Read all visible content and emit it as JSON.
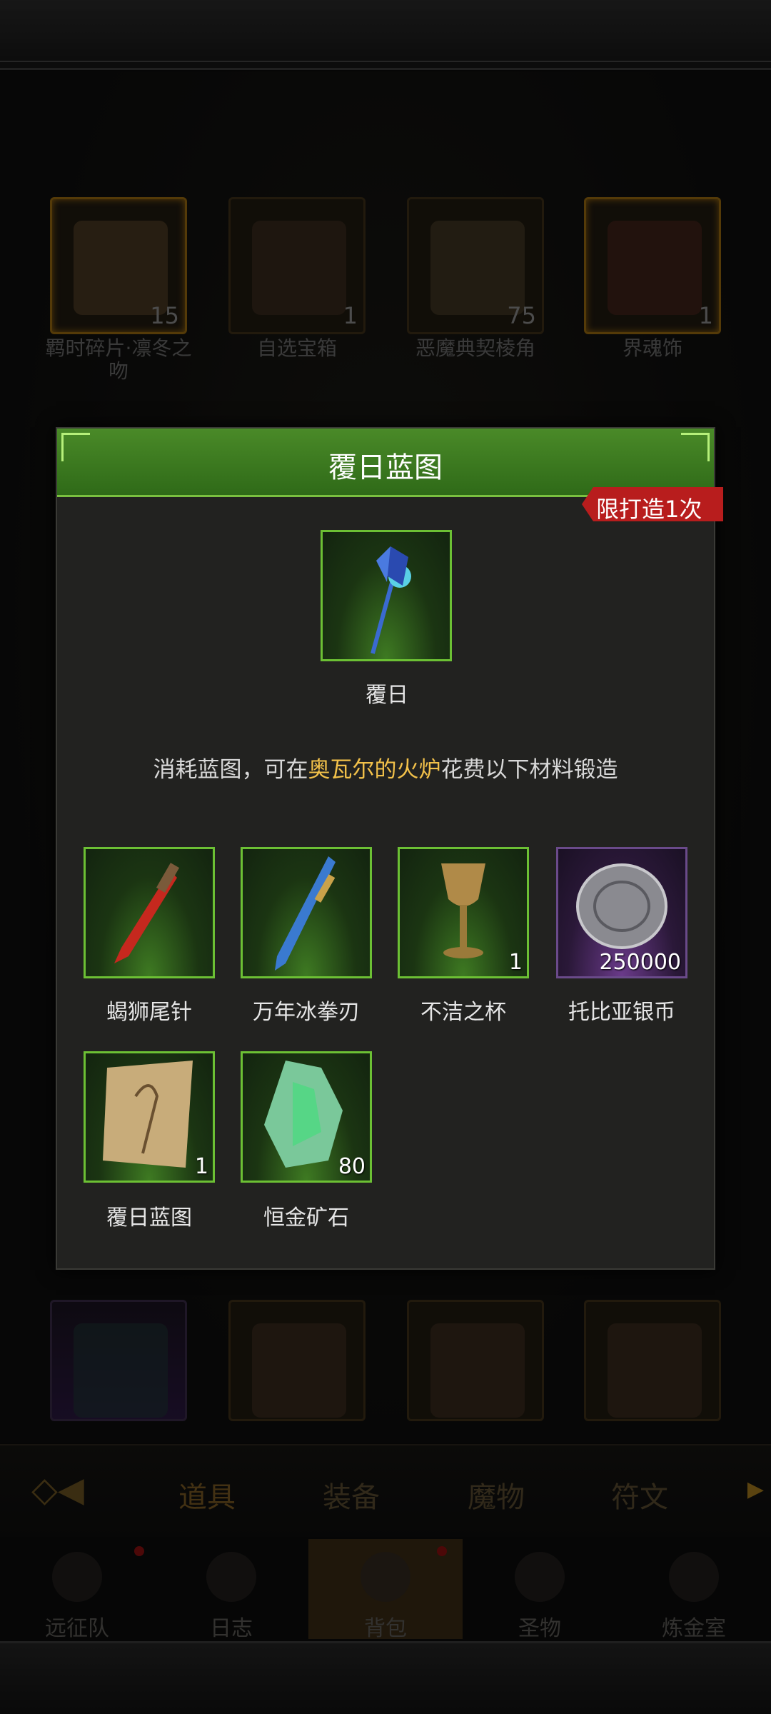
{
  "background": {
    "items": [
      {
        "label": "羁时碎片·凛冬之吻",
        "count": "15"
      },
      {
        "label": "自选宝箱",
        "count": "1"
      },
      {
        "label": "恶魔典契棱角",
        "count": "75"
      },
      {
        "label": "界魂饰",
        "count": "1"
      }
    ],
    "tabs": [
      "道具",
      "装备",
      "魔物",
      "符文"
    ],
    "nav": [
      "远征队",
      "日志",
      "背包",
      "圣物",
      "炼金室"
    ]
  },
  "modal": {
    "title": "覆日蓝图",
    "limit_badge": "限打造1次",
    "result_item": {
      "name": "覆日"
    },
    "description_prefix": "消耗蓝图，可在",
    "description_highlight": "奥瓦尔的火炉",
    "description_suffix": "花费以下材料锻造",
    "highlight_color": "#f2c14a",
    "materials": [
      {
        "name": "蝎狮尾针",
        "count": ""
      },
      {
        "name": "万年冰拳刃",
        "count": ""
      },
      {
        "name": "不洁之杯",
        "count": "1"
      },
      {
        "name": "托比亚银币",
        "count": "250000"
      },
      {
        "name": "覆日蓝图",
        "count": "1"
      },
      {
        "name": "恒金矿石",
        "count": "80"
      }
    ]
  }
}
